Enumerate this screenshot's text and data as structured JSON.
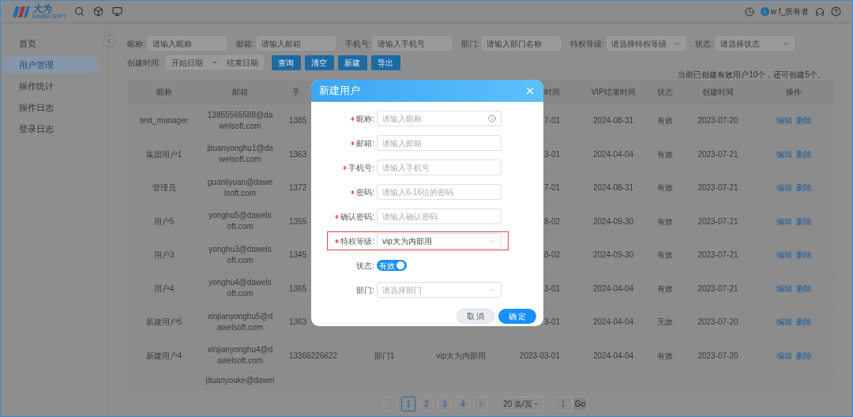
{
  "header": {
    "logo": {
      "text": "大为",
      "subtext": "DAWEI SOFT"
    },
    "user": "w f_所有者"
  },
  "sidebar": {
    "items": [
      {
        "label": "首页",
        "selected": false
      },
      {
        "label": "用户管理",
        "selected": true
      },
      {
        "label": "操作统计",
        "selected": false
      },
      {
        "label": "操作日志",
        "selected": false
      },
      {
        "label": "登录日志",
        "selected": false
      }
    ]
  },
  "filters": {
    "fields": [
      {
        "label": "昵称:",
        "placeholder": "请输入昵称",
        "kind": "input"
      },
      {
        "label": "邮箱:",
        "placeholder": "请输入邮箱",
        "kind": "input"
      },
      {
        "label": "手机号:",
        "placeholder": "请输入手机号",
        "kind": "input"
      },
      {
        "label": "部门:",
        "placeholder": "请输入部门名称",
        "kind": "input"
      },
      {
        "label": "特权等级:",
        "placeholder": "请选择特权等级",
        "kind": "select"
      },
      {
        "label": "状态:",
        "placeholder": "请选择状态",
        "kind": "select"
      }
    ],
    "date_range": {
      "label": "创建时间:",
      "start_placeholder": "开始日期",
      "separator": "~",
      "end_placeholder": "结束日期"
    },
    "buttons": [
      "查询",
      "清空",
      "新建",
      "导出"
    ]
  },
  "quota_note": "当前已创建有效用户10个，还可创建5个。",
  "table": {
    "columns": {
      "nickname": "昵称",
      "email": "邮箱",
      "phone": "手",
      "vip_start": "时间",
      "vip_end": "VIP结束时间",
      "status": "状态",
      "created": "创建时间",
      "actions": "操作"
    },
    "rows": [
      {
        "nickname": "test_manager",
        "email": "13855565588@dawelsoft.com",
        "phone": "1385",
        "vip_start": "7-01",
        "vip_end": "2024-08-31",
        "status": "有效",
        "created": "2023-07-20",
        "actions": [
          "编辑",
          "删除"
        ]
      },
      {
        "nickname": "集团用户1",
        "email": "jituanyonghu1@dawelsoft.com",
        "phone": "1363",
        "vip_start": "3-01",
        "vip_end": "2024-04-04",
        "status": "有效",
        "created": "2023-07-21",
        "actions": [
          "编辑",
          "删除"
        ]
      },
      {
        "nickname": "管理员",
        "email": "guanliyuan@dawelsoft.com",
        "phone": "1372",
        "vip_start": "7-01",
        "vip_end": "2024-08-31",
        "status": "有效",
        "created": "2023-07-21",
        "actions": [
          "编辑",
          "删除"
        ]
      },
      {
        "nickname": "用户5",
        "email": "yonghu5@dawelsoft.com",
        "phone": "1355",
        "vip_start": "8-02",
        "vip_end": "2024-09-30",
        "status": "有效",
        "created": "2023-07-21",
        "actions": [
          "编辑",
          "删除"
        ]
      },
      {
        "nickname": "用户3",
        "email": "yonghu3@dawelsoft.com",
        "phone": "1345",
        "vip_start": "8-02",
        "vip_end": "2024-09-30",
        "status": "有效",
        "created": "2023-07-21",
        "actions": [
          "编辑",
          "删除"
        ]
      },
      {
        "nickname": "用户4",
        "email": "yonghu4@dawelsoft.com",
        "phone": "1365",
        "vip_start": "3-01",
        "vip_end": "2024-04-04",
        "status": "有效",
        "created": "2023-07-21",
        "actions": [
          "编辑",
          "删除"
        ]
      },
      {
        "nickname": "新建用户5",
        "email": "xinjianyonghu5@dawelsoft.com",
        "phone": "1363",
        "vip_start": "3-01",
        "vip_end": "2024-04-04",
        "status": "无效",
        "created": "2023-07-20",
        "actions": [
          "编辑",
          "删除"
        ]
      },
      {
        "nickname": "新建用户4",
        "email": "xinjianyonghu4@dawelsoft.com",
        "phone": "13366226622",
        "department": "部门1",
        "privilege": "vip大为内部用",
        "vip_start": "2023-03-01",
        "vip_end": "2024-04-04",
        "status": "有效",
        "created": "2023-07-20",
        "actions": [
          "编辑",
          "删除"
        ]
      },
      {
        "email": "jituanyouke@dawei"
      }
    ]
  },
  "pagination": {
    "pages": [
      {
        "label": "1",
        "selected": true
      },
      {
        "label": "2",
        "selected": false
      },
      {
        "label": "3",
        "selected": false
      },
      {
        "label": "4",
        "selected": false
      }
    ],
    "page_size": "20 条/页",
    "jump_value": "1",
    "go": "Go"
  },
  "dialog": {
    "title": "新建用户",
    "fields": [
      {
        "label": "昵称:",
        "required": true,
        "kind": "input",
        "placeholder": "请输入昵称",
        "info": true
      },
      {
        "label": "邮箱:",
        "required": true,
        "kind": "input",
        "placeholder": "请输入邮箱"
      },
      {
        "label": "手机号:",
        "required": true,
        "kind": "input",
        "placeholder": "请输入手机号"
      },
      {
        "label": "密码:",
        "required": true,
        "kind": "input",
        "placeholder": "请输入6-16位的密码"
      },
      {
        "label": "确认密码:",
        "required": true,
        "kind": "input",
        "placeholder": "请输入确认密码"
      },
      {
        "label": "特权等级:",
        "required": true,
        "kind": "select",
        "value": "vip大为内部用",
        "highlighted": true
      },
      {
        "label": "状态:",
        "required": false,
        "kind": "switch",
        "on": true,
        "text": "有效"
      },
      {
        "label": "部门:",
        "required": false,
        "kind": "select",
        "placeholder": "请选择部门"
      }
    ],
    "buttons": [
      {
        "label": "取 消",
        "primary": false
      },
      {
        "label": "确 定",
        "primary": true
      }
    ]
  }
}
